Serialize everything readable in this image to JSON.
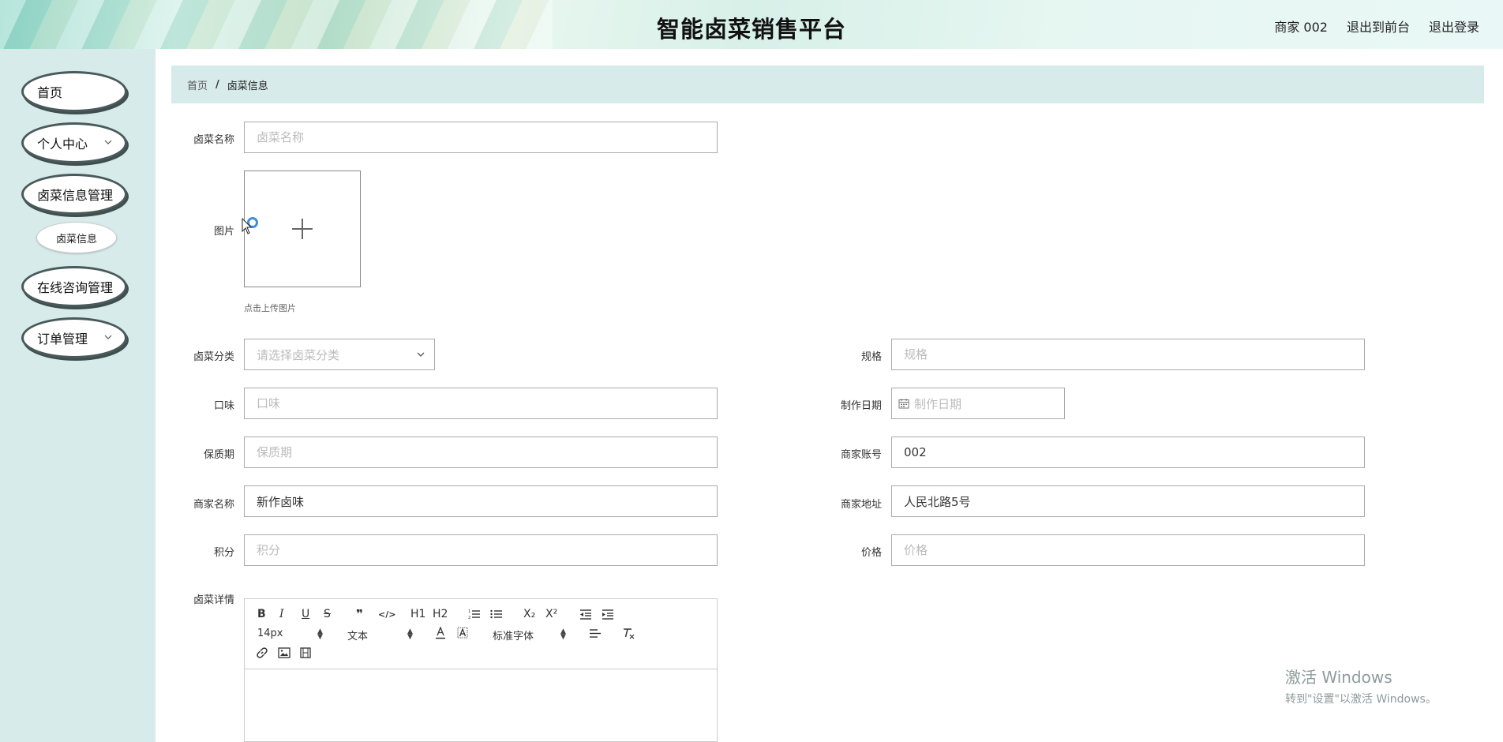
{
  "header": {
    "title": "智能卤菜销售平台",
    "user": "商家 002",
    "back_to_front": "退出到前台",
    "logout": "退出登录"
  },
  "sidebar": {
    "items": [
      {
        "label": "首页"
      },
      {
        "label": "个人中心"
      },
      {
        "label": "卤菜信息管理"
      },
      {
        "label": "卤菜信息"
      },
      {
        "label": "在线咨询管理"
      },
      {
        "label": "订单管理"
      }
    ]
  },
  "breadcrumb": {
    "home": "首页",
    "separator": "/",
    "current": "卤菜信息"
  },
  "form": {
    "name": {
      "label": "卤菜名称",
      "placeholder": "卤菜名称",
      "value": ""
    },
    "image": {
      "label": "图片",
      "hint": "点击上传图片"
    },
    "category": {
      "label": "卤菜分类",
      "placeholder": "请选择卤菜分类"
    },
    "spec": {
      "label": "规格",
      "placeholder": "规格",
      "value": ""
    },
    "taste": {
      "label": "口味",
      "placeholder": "口味",
      "value": ""
    },
    "make_date": {
      "label": "制作日期",
      "placeholder": "制作日期"
    },
    "shelf_life": {
      "label": "保质期",
      "placeholder": "保质期",
      "value": ""
    },
    "merchant_account": {
      "label": "商家账号",
      "placeholder": "",
      "value": "002"
    },
    "merchant_name": {
      "label": "商家名称",
      "placeholder": "",
      "value": "新作卤味"
    },
    "merchant_address": {
      "label": "商家地址",
      "placeholder": "",
      "value": "人民北路5号"
    },
    "points": {
      "label": "积分",
      "placeholder": "积分",
      "value": ""
    },
    "price": {
      "label": "价格",
      "placeholder": "价格",
      "value": ""
    },
    "detail": {
      "label": "卤菜详情"
    }
  },
  "editor": {
    "bold": "B",
    "italic": "I",
    "underline": "U",
    "strike": "S",
    "quote": "❞",
    "code": "</>",
    "h1": "H1",
    "h2": "H2",
    "sub": "X₂",
    "sup": "X²",
    "font_size": "14px",
    "block_type": "文本",
    "font_family": "标准字体"
  },
  "watermark": {
    "line1": "激活 Windows",
    "line2": "转到\"设置\"以激活 Windows。"
  }
}
